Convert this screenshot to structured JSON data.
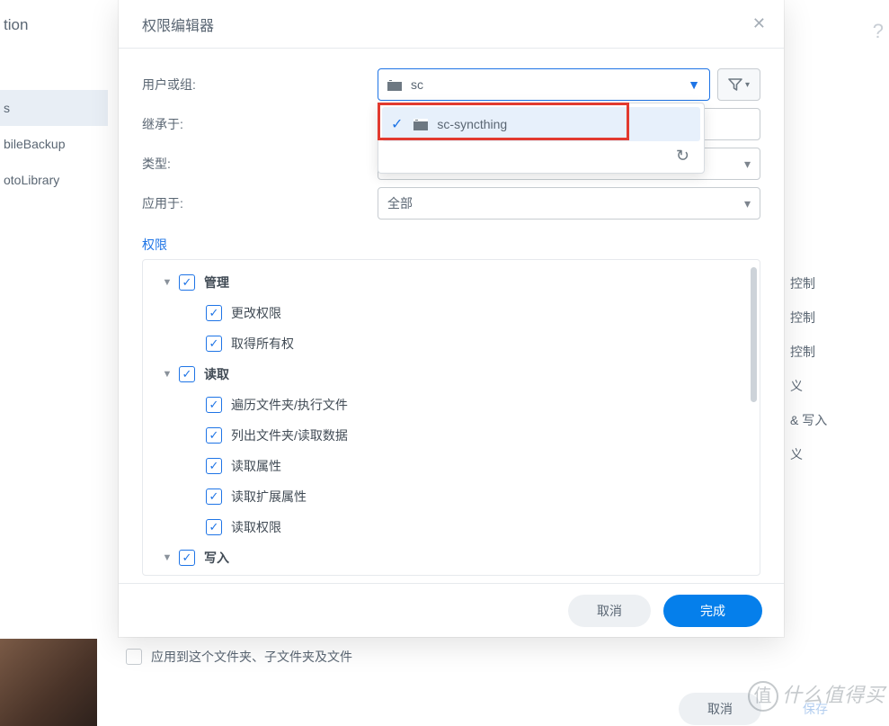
{
  "bg": {
    "title_fragment": "tion",
    "sidebar": [
      "s",
      "bileBackup",
      "otoLibrary"
    ],
    "right": [
      "控制",
      "控制",
      "控制",
      "义",
      "& 写入",
      "义"
    ],
    "bottom_cb": "应用到这个文件夹、子文件夹及文件",
    "cancel": "取消",
    "save_ghost": "保存",
    "watermark": "什么值得买"
  },
  "modal": {
    "title": "权限编辑器",
    "rows": {
      "user_or_group": "用户或组:",
      "inherit": "继承于:",
      "type": "类型:",
      "apply_to": "应用于:"
    },
    "values": {
      "user_or_group": "sc",
      "apply_to": "全部"
    },
    "dropdown_item": "sc-syncthing",
    "section": "权限",
    "tree": {
      "manage": "管理",
      "manage_items": [
        "更改权限",
        "取得所有权"
      ],
      "read": "读取",
      "read_items": [
        "遍历文件夹/执行文件",
        "列出文件夹/读取数据",
        "读取属性",
        "读取扩展属性",
        "读取权限"
      ],
      "write": "写入"
    },
    "cancel": "取消",
    "done": "完成"
  }
}
